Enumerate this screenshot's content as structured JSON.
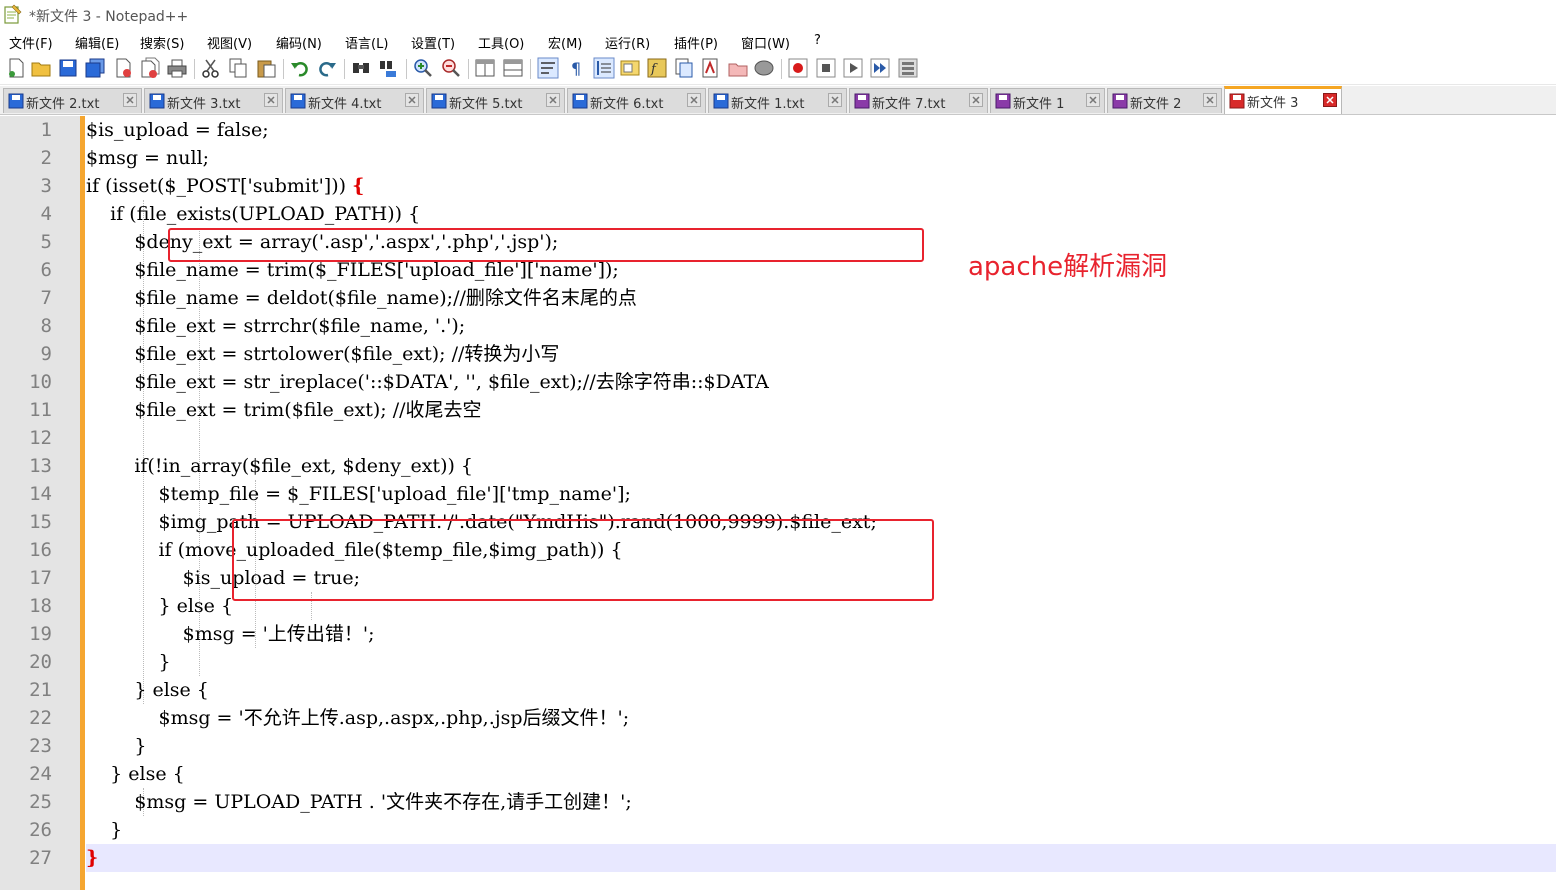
{
  "window": {
    "title": "*新文件 3 - Notepad++"
  },
  "menu": [
    "文件(F)",
    "编辑(E)",
    "搜索(S)",
    "视图(V)",
    "编码(N)",
    "语言(L)",
    "设置(T)",
    "工具(O)",
    "宏(M)",
    "运行(R)",
    "插件(P)",
    "窗口(W)",
    "?"
  ],
  "toolbar_icons": [
    "new-file-icon",
    "open-file-icon",
    "save-icon",
    "save-all-icon",
    "close-icon",
    "close-all-icon",
    "print-icon",
    "cut-icon",
    "copy-icon",
    "paste-icon",
    "undo-icon",
    "redo-icon",
    "find-icon",
    "replace-icon",
    "zoom-in-icon",
    "zoom-out-icon",
    "sync-vertical-icon",
    "sync-horizontal-icon",
    "word-wrap-icon",
    "show-all-chars-icon",
    "indent-guide-icon",
    "doc-map-icon",
    "function-list-icon",
    "folder-workspace-icon",
    "monitoring-icon",
    "folder-icon",
    "ellipse-icon",
    "record-macro-icon",
    "stop-macro-icon",
    "play-macro-icon",
    "run-macro-multiple-icon",
    "save-macro-icon"
  ],
  "tabs": [
    {
      "label": "新文件 2.txt",
      "active": false
    },
    {
      "label": "新文件 3.txt",
      "active": false
    },
    {
      "label": "新文件 4.txt",
      "active": false
    },
    {
      "label": "新文件 5.txt",
      "active": false
    },
    {
      "label": "新文件 6.txt",
      "active": false
    },
    {
      "label": "新文件 1.txt",
      "active": false
    },
    {
      "label": "新文件 7.txt",
      "active": false
    },
    {
      "label": "新文件 1",
      "active": false
    },
    {
      "label": "新文件 2",
      "active": false
    },
    {
      "label": "新文件 3",
      "active": true
    }
  ],
  "colors": {
    "fold_margin": "#f5a630",
    "annotation": "#e8232e",
    "brace": "#e00000",
    "current_line": "#e8e8ff"
  },
  "editor": {
    "current_line": 27,
    "lines": [
      "$is_upload = false;",
      "$msg = null;",
      "if (isset($_POST['submit'])) {",
      "    if (file_exists(UPLOAD_PATH)) {",
      "        $deny_ext = array('.asp','.aspx','.php','.jsp');",
      "        $file_name = trim($_FILES['upload_file']['name']);",
      "        $file_name = deldot($file_name);//删除文件名末尾的点",
      "        $file_ext = strrchr($file_name, '.');",
      "        $file_ext = strtolower($file_ext); //转换为小写",
      "        $file_ext = str_ireplace('::$DATA', '', $file_ext);//去除字符串::$DATA",
      "        $file_ext = trim($file_ext); //收尾去空",
      "",
      "        if(!in_array($file_ext, $deny_ext)) {",
      "            $temp_file = $_FILES['upload_file']['tmp_name'];",
      "            $img_path = UPLOAD_PATH.'/'.date(\"YmdHis\").rand(1000,9999).$file_ext;",
      "            if (move_uploaded_file($temp_file,$img_path)) {",
      "                $is_upload = true;",
      "            } else {",
      "                $msg = '上传出错！';",
      "            }",
      "        } else {",
      "            $msg = '不允许上传.asp,.aspx,.php,.jsp后缀文件！';",
      "        }",
      "    } else {",
      "        $msg = UPLOAD_PATH . '文件夹不存在,请手工创建！';",
      "    }",
      "}"
    ]
  },
  "annotation": {
    "text": "apache解析漏洞"
  }
}
